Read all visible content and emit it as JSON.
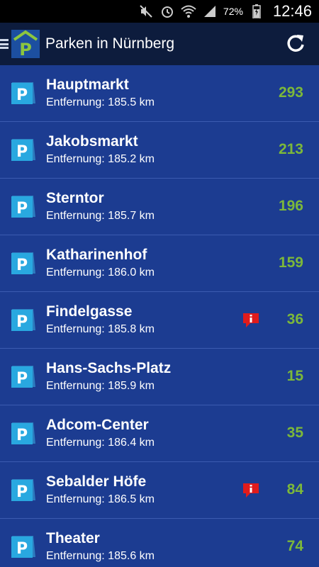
{
  "status_bar": {
    "battery_percent": "72%",
    "time": "12:46",
    "icons": [
      "mute-icon",
      "alarm-icon",
      "wifi-icon",
      "signal-icon",
      "battery-icon"
    ]
  },
  "action_bar": {
    "title": "Parken in Nürnberg",
    "icons": [
      "menu-icon",
      "parking-logo-icon",
      "refresh-icon"
    ]
  },
  "colors": {
    "header_bg": "#0d1c3d",
    "list_bg": "#1c3c91",
    "free_count": "#7cb83a",
    "info_badge": "#e01b1b",
    "parking_icon": "#29a8e0"
  },
  "car_parks": [
    {
      "name": "Hauptmarkt",
      "distance": "Entfernung: 185.5 km",
      "free": "293",
      "info": false
    },
    {
      "name": "Jakobsmarkt",
      "distance": "Entfernung: 185.2 km",
      "free": "213",
      "info": false
    },
    {
      "name": "Sterntor",
      "distance": "Entfernung: 185.7 km",
      "free": "196",
      "info": false
    },
    {
      "name": "Katharinenhof",
      "distance": "Entfernung: 186.0 km",
      "free": "159",
      "info": false
    },
    {
      "name": "Findelgasse",
      "distance": "Entfernung: 185.8 km",
      "free": "36",
      "info": true
    },
    {
      "name": "Hans-Sachs-Platz",
      "distance": "Entfernung: 185.9 km",
      "free": "15",
      "info": false
    },
    {
      "name": "Adcom-Center",
      "distance": "Entfernung: 186.4 km",
      "free": "35",
      "info": false
    },
    {
      "name": "Sebalder Höfe",
      "distance": "Entfernung: 186.5 km",
      "free": "84",
      "info": true
    },
    {
      "name": "Theater",
      "distance": "Entfernung: 185.6 km",
      "free": "74",
      "info": false
    }
  ]
}
